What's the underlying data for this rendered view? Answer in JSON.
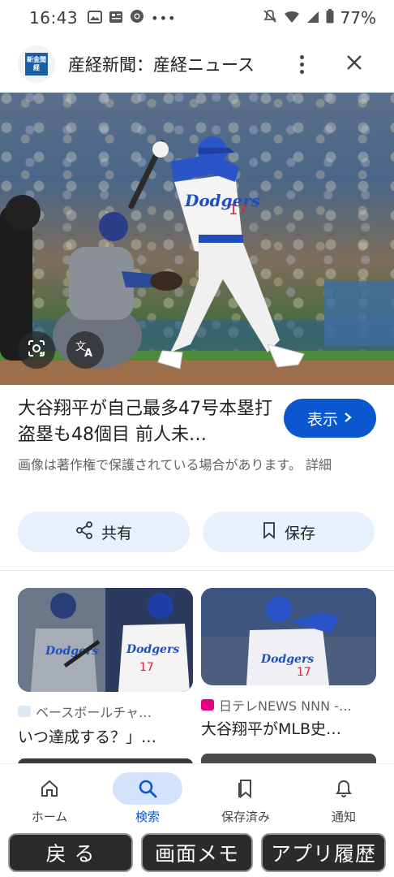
{
  "status_bar": {
    "time": "16:43",
    "battery": "77%"
  },
  "header": {
    "site_name": "産経新聞：産経ニュース",
    "logo_text": "新金聞経"
  },
  "result": {
    "title": "大谷翔平が自己最多47号本塁打 盗塁も48個目 前人未…",
    "show_button": "表示",
    "notice": "画像は著作権で保護されている場合があります。 詳細"
  },
  "actions": {
    "share_label": "共有",
    "save_label": "保存"
  },
  "related": [
    {
      "source": "ベースボールチャ…",
      "caption": "いつ達成する？」…"
    },
    {
      "source": "日テレNEWS NNN -…",
      "caption": "大谷翔平がMLB史…"
    }
  ],
  "bottom_nav": [
    {
      "label": "ホーム",
      "icon": "home-icon",
      "active": false
    },
    {
      "label": "検索",
      "icon": "search-icon",
      "active": true
    },
    {
      "label": "保存済み",
      "icon": "bookmark-icon",
      "active": false
    },
    {
      "label": "通知",
      "icon": "bell-icon",
      "active": false
    }
  ],
  "system_buttons": {
    "back": "戻 る",
    "memo": "画面メモ",
    "history": "アプリ履歴"
  },
  "colors": {
    "accent": "#0b57d0",
    "chip_bg": "#e8f0fe",
    "nav_active_bg": "#d3e3fd"
  }
}
